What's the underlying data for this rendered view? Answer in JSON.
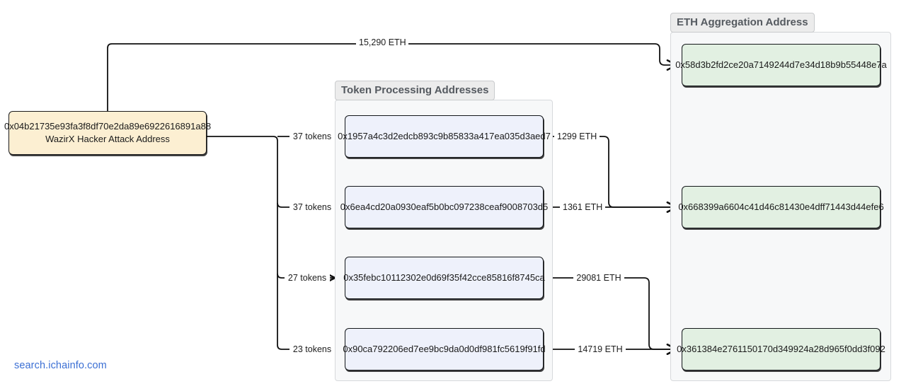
{
  "watermark": "search.ichainfo.com",
  "clusters": [
    {
      "id": "token_processing",
      "label": "Token Processing Addresses"
    },
    {
      "id": "eth_aggregation",
      "label": "ETH Aggregation Address"
    }
  ],
  "nodes": {
    "attacker": {
      "address": "0x04b21735e93fa3f8df70e2da89e6922616891a88",
      "name": "WazirX Hacker Attack Address",
      "fill": "#fcefd2"
    },
    "token_addresses": [
      {
        "address": "0x1957a4c3d2edcb893c9b85833a417ea035d3aed7",
        "fill": "#eef1fb"
      },
      {
        "address": "0x6ea4cd20a0930eaf5b0bc097238ceaf9008703d5",
        "fill": "#eef1fb"
      },
      {
        "address": "0x35febc10112302e0d69f35f42cce85816f8745ca",
        "fill": "#eef1fb"
      },
      {
        "address": "0x90ca792206ed7ee9bc9da0d0df981fc5619f91fd",
        "fill": "#eef1fb"
      }
    ],
    "aggregation_addresses": [
      {
        "address": "0x58d3b2fd2ce20a7149244d7e34d18b9b55448e7a",
        "fill": "#e2f0e2"
      },
      {
        "address": "0x668399a6604c41d46c81430e4dff71443d44efe6",
        "fill": "#e2f0e2"
      },
      {
        "address": "0x361384e2761150170d349924a28d965f0dd3f092",
        "fill": "#e2f0e2"
      }
    ]
  },
  "edges": [
    {
      "id": "eth_direct",
      "label": "15,290 ETH",
      "from": "attacker",
      "to": "agg_1"
    },
    {
      "id": "tokens_1",
      "label": "37 tokens",
      "from": "attacker",
      "to": "token_1"
    },
    {
      "id": "tokens_2",
      "label": "37 tokens",
      "from": "attacker",
      "to": "token_2"
    },
    {
      "id": "tokens_3",
      "label": "27 tokens",
      "from": "attacker",
      "to": "token_3"
    },
    {
      "id": "tokens_4",
      "label": "23 tokens",
      "from": "attacker",
      "to": "token_4"
    },
    {
      "id": "eth_1",
      "label": "1299 ETH",
      "from": "token_1",
      "to": "agg_2"
    },
    {
      "id": "eth_2",
      "label": "1361 ETH",
      "from": "token_2",
      "to": "agg_2"
    },
    {
      "id": "eth_3",
      "label": "29081 ETH",
      "from": "token_3",
      "to": "agg_3"
    },
    {
      "id": "eth_4",
      "label": "14719 ETH",
      "from": "token_4",
      "to": "agg_3"
    }
  ]
}
